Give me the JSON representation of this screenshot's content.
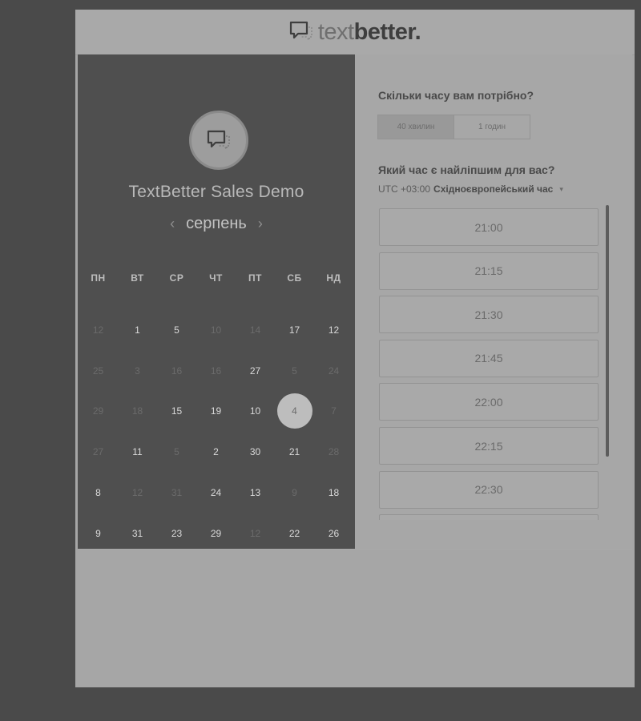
{
  "header": {
    "logo_light": "text",
    "logo_bold": "better",
    "logo_dot": "."
  },
  "event": {
    "title": "TextBetter Sales Demo"
  },
  "calendar": {
    "month": "серпень",
    "prev_icon": "chevron-left-icon",
    "next_icon": "chevron-right-icon",
    "weekdays": [
      "ПН",
      "ВТ",
      "СР",
      "ЧТ",
      "ПТ",
      "СБ",
      "НД"
    ],
    "weeks": [
      [
        {
          "d": "12",
          "s": "muted"
        },
        {
          "d": "1",
          "s": "active"
        },
        {
          "d": "5",
          "s": "active"
        },
        {
          "d": "10",
          "s": "muted"
        },
        {
          "d": "14",
          "s": "muted"
        },
        {
          "d": "17",
          "s": "active"
        },
        {
          "d": "12",
          "s": "active"
        }
      ],
      [
        {
          "d": "25",
          "s": "muted"
        },
        {
          "d": "3",
          "s": "muted"
        },
        {
          "d": "16",
          "s": "muted"
        },
        {
          "d": "16",
          "s": "muted"
        },
        {
          "d": "27",
          "s": "active"
        },
        {
          "d": "5",
          "s": "muted"
        },
        {
          "d": "24",
          "s": "muted"
        }
      ],
      [
        {
          "d": "29",
          "s": "muted"
        },
        {
          "d": "18",
          "s": "muted"
        },
        {
          "d": "15",
          "s": "active"
        },
        {
          "d": "19",
          "s": "active"
        },
        {
          "d": "10",
          "s": "active"
        },
        {
          "d": "4",
          "s": "selected"
        },
        {
          "d": "7",
          "s": "muted"
        }
      ],
      [
        {
          "d": "27",
          "s": "muted"
        },
        {
          "d": "11",
          "s": "active"
        },
        {
          "d": "5",
          "s": "muted"
        },
        {
          "d": "2",
          "s": "active"
        },
        {
          "d": "30",
          "s": "active"
        },
        {
          "d": "21",
          "s": "active"
        },
        {
          "d": "28",
          "s": "muted"
        }
      ],
      [
        {
          "d": "8",
          "s": "active"
        },
        {
          "d": "12",
          "s": "muted"
        },
        {
          "d": "31",
          "s": "muted"
        },
        {
          "d": "24",
          "s": "active"
        },
        {
          "d": "13",
          "s": "active"
        },
        {
          "d": "9",
          "s": "muted"
        },
        {
          "d": "18",
          "s": "active"
        }
      ],
      [
        {
          "d": "9",
          "s": "active"
        },
        {
          "d": "31",
          "s": "active"
        },
        {
          "d": "23",
          "s": "active"
        },
        {
          "d": "29",
          "s": "active"
        },
        {
          "d": "12",
          "s": "muted"
        },
        {
          "d": "22",
          "s": "active"
        },
        {
          "d": "26",
          "s": "active"
        }
      ]
    ]
  },
  "duration": {
    "question": "Скільки часу вам потрібно?",
    "options": [
      "40 хвилин",
      "1 годин"
    ],
    "selected_index": 0
  },
  "time": {
    "question": "Який час є найліпшим для вас?",
    "tz_offset": "UTC +03:00",
    "tz_name": "Східноєвропейський час",
    "tz_caret": "▾",
    "slots": [
      "21:00",
      "21:15",
      "21:30",
      "21:45",
      "22:00",
      "22:15",
      "22:30",
      ""
    ]
  }
}
